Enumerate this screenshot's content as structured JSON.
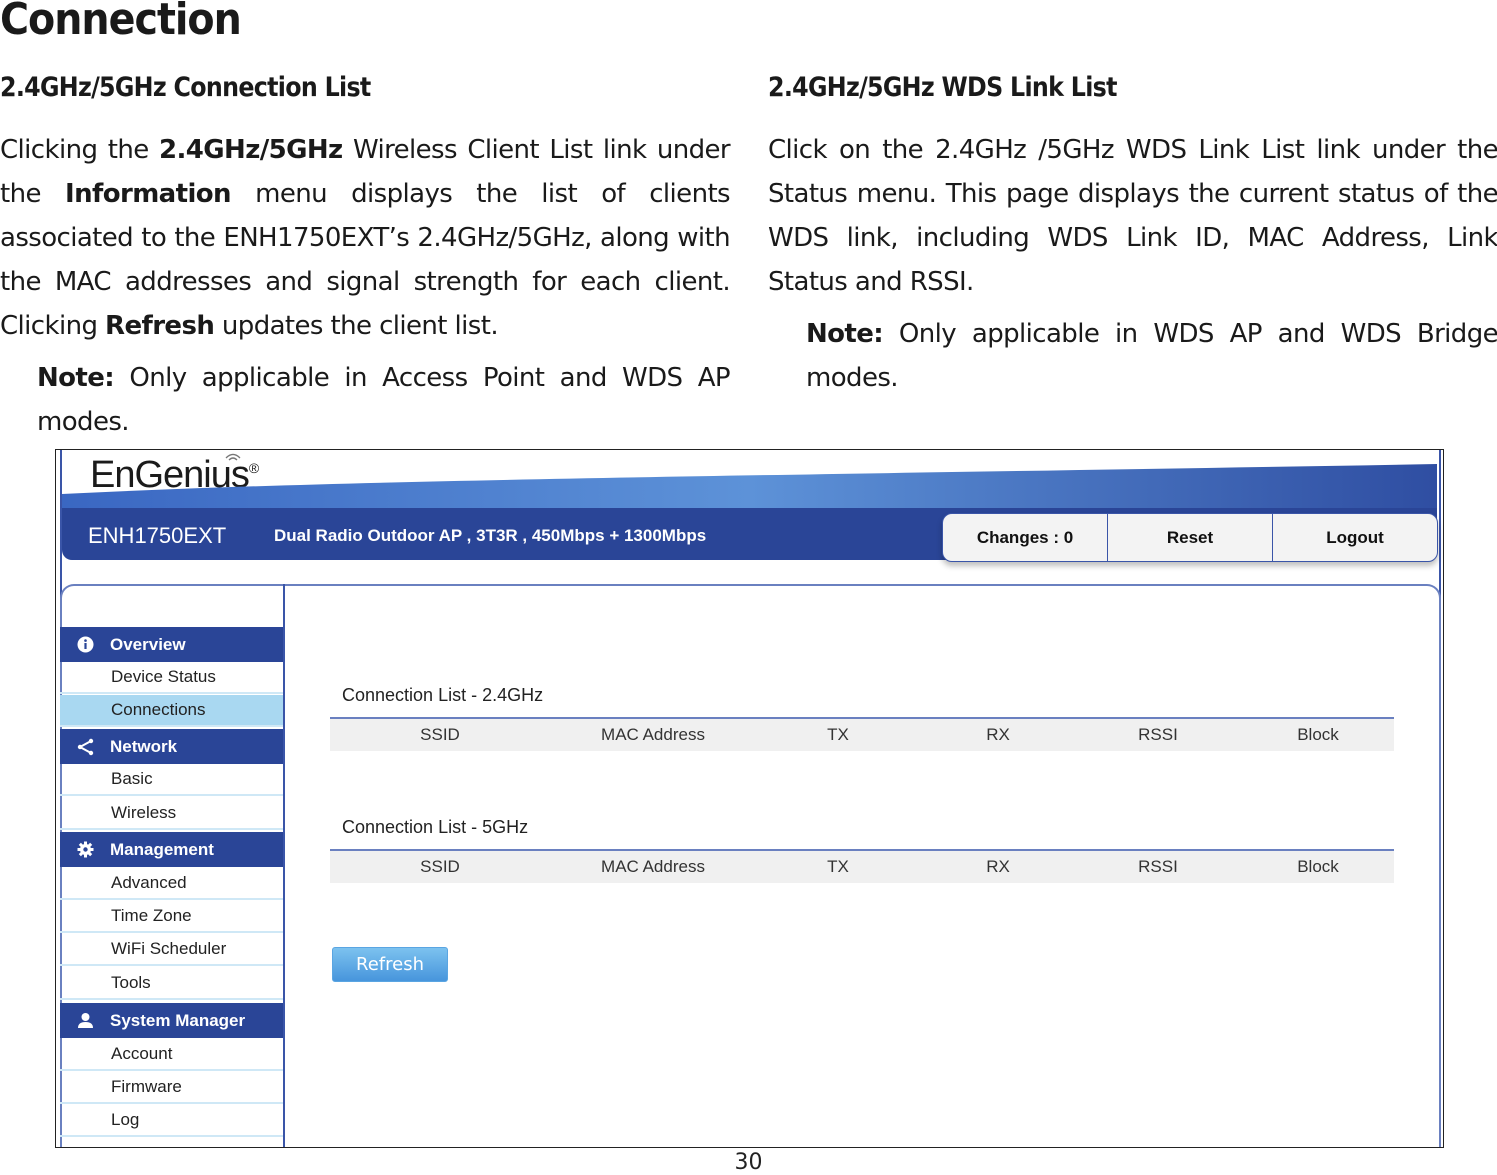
{
  "page": {
    "title": "Connection",
    "page_number": "30"
  },
  "left": {
    "heading": "2.4GHz/5GHz Connection List",
    "para_parts": [
      "Clicking the ",
      "2.4GHz/5GHz",
      " Wireless Client List link under the ",
      "Information",
      " menu displays the list of clients associated to the ENH1750EXT’s 2.4GHz/5GHz, along with the MAC addresses and signal strength for each client. Clicking ",
      "Refresh",
      " updates the client list."
    ],
    "note_label": "Note:",
    "note_text": " Only applicable in Access Point and WDS AP modes."
  },
  "right": {
    "heading": "2.4GHz/5GHz WDS Link List",
    "para": "Click on the 2.4GHz /5GHz WDS Link List link under the Status menu. This page displays the current status of the WDS link, including WDS Link ID, MAC Address, Link Status and RSSI.",
    "note_label": "Note:",
    "note_text": " Only applicable in WDS AP and WDS Bridge modes."
  },
  "screenshot": {
    "logo": "EnGenius",
    "logo_mark": "®",
    "model": "ENH1750EXT",
    "tagline": "Dual Radio Outdoor AP , 3T3R , 450Mbps + 1300Mbps",
    "header_buttons": [
      "Changes : 0",
      "Reset",
      "Logout"
    ],
    "colors": {
      "banner": "#2a4597",
      "active_item": "#a9d8f1",
      "refresh": "#4795dc"
    },
    "sidebar": {
      "groups": [
        {
          "label": "Overview",
          "icon": "info-icon",
          "items": [
            "Device Status",
            "Connections"
          ]
        },
        {
          "label": "Network",
          "icon": "share-icon",
          "items": [
            "Basic",
            "Wireless"
          ]
        },
        {
          "label": "Management",
          "icon": "gear-icon",
          "items": [
            "Advanced",
            "Time Zone",
            "WiFi Scheduler",
            "Tools"
          ]
        },
        {
          "label": "System Manager",
          "icon": "user-icon",
          "items": [
            "Account",
            "Firmware",
            "Log"
          ]
        }
      ],
      "active_item": "Connections"
    },
    "tables": [
      {
        "title": "Connection List - 2.4GHz",
        "columns": [
          "SSID",
          "MAC Address",
          "TX",
          "RX",
          "RSSI",
          "Block"
        ],
        "rows": []
      },
      {
        "title": "Connection List - 5GHz",
        "columns": [
          "SSID",
          "MAC Address",
          "TX",
          "RX",
          "RSSI",
          "Block"
        ],
        "rows": []
      }
    ],
    "refresh_label": "Refresh"
  }
}
